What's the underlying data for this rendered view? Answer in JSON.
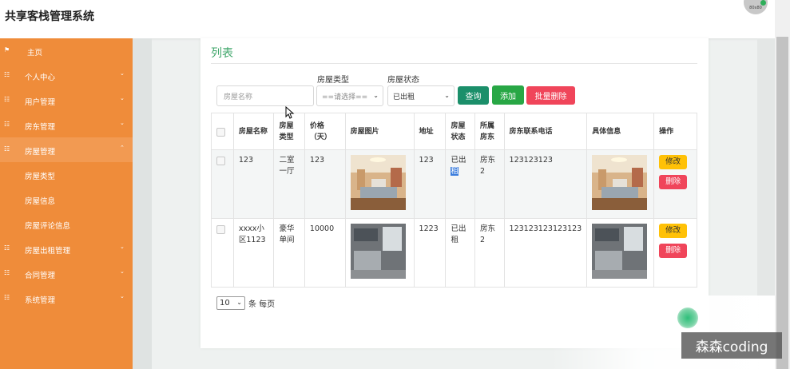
{
  "app": {
    "title": "共享客栈管理系统",
    "avatar_text": "80x80"
  },
  "sidebar": {
    "items": [
      {
        "label": "主页",
        "icon": "flag-icon"
      },
      {
        "label": "个人中心",
        "icon": "grid-icon"
      },
      {
        "label": "用户管理",
        "icon": "grid-icon"
      },
      {
        "label": "房东管理",
        "icon": "grid-icon"
      },
      {
        "label": "房屋管理",
        "icon": "grid-icon"
      },
      {
        "label": "房屋出租管理",
        "icon": "grid-icon"
      },
      {
        "label": "合同管理",
        "icon": "grid-icon"
      },
      {
        "label": "系统管理",
        "icon": "grid-icon"
      }
    ],
    "sub_items": [
      {
        "label": "房屋类型"
      },
      {
        "label": "房屋信息"
      },
      {
        "label": "房屋评论信息"
      }
    ]
  },
  "main": {
    "title": "列表",
    "filters": {
      "name_placeholder": "房屋名称",
      "type_label": "房屋类型",
      "type_value": "==请选择==",
      "status_label": "房屋状态",
      "status_value": "已出租"
    },
    "buttons": {
      "search": "查询",
      "add": "添加",
      "batch_delete": "批量删除"
    },
    "table": {
      "headers": [
        "房屋名称",
        "房屋类型",
        "价格（天）",
        "房屋图片",
        "地址",
        "房屋状态",
        "所属房东",
        "房东联系电话",
        "具体信息",
        "操作"
      ],
      "rows": [
        {
          "name": "123",
          "type": "二室一厅",
          "price": "123",
          "address": "123",
          "status_a": "已出",
          "status_b": "租",
          "owner": "房东2",
          "phone": "123123123"
        },
        {
          "name": "xxxx小区1123",
          "type": "豪华单间",
          "price": "10000",
          "address": "1223",
          "status_a": "已出",
          "status_b": "租",
          "owner": "房东2",
          "phone": "123123123123123"
        }
      ],
      "edit_label": "修改",
      "delete_label": "删除"
    },
    "pager": {
      "page_size": "10",
      "suffix": "条 每页"
    }
  },
  "watermark": "森森coding",
  "colors": {
    "sidebar": "#ef8c3a",
    "accent_green": "#3fa66a",
    "search_btn": "#1b8f6a",
    "add_btn": "#28a745",
    "delete_btn": "#f0455a",
    "edit_btn": "#ffc107"
  }
}
